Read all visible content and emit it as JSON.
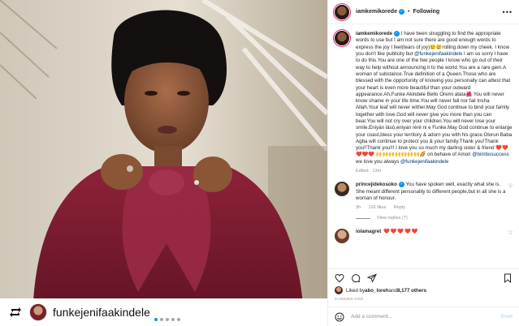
{
  "header": {
    "username": "iamkemikorede",
    "separator": "•",
    "follow_state": "Following",
    "more_icon": "more-horizontal-icon"
  },
  "caption": {
    "username": "iamkemikorede",
    "text_1": " I have been struggling to find the appropriate words to use but I am not sure there are good enough words to express the joy I feel(tears of joy)😢😢rolling down my cheek. I know you don't like publicity but ",
    "mention_1": "@funkejenifaakindele",
    "text_2": " I am so sorry I have to do this.You are one of the few people I know who go out of their way to help without announcing it to the world.You are a rare gem.A woman of substance.True definition of a Queen.Those who are blessed with the opportunity of knowing you personally can attest that your heart is even more beautiful than your outward appearance.Ah,Funke Akindele Bello Oremi atata🌺 You will never know shame in your life time.You will never fall nor fail Insha Allah.Your leaf will never wither.May God continue to bind your family together with love.God will never give you more than you can bear.You will not cry over your children.You will never lose your smile.Eniyàn lásò,eniyan rèré ni e Funke.May God continue to enlarge your coast,bless your territory & adorn you with his grace.Olorun Baba Agba will continue to protect you & your family.Thank you!Thank you!!Thank you!!! I love you so much my darling sister & friend ❤️❤️❤️❤️❤️ 🙌🙌🙌🙌🙌🙌🙌🌈 on behave of Amori ",
    "mention_2": "@bimbosuccess",
    "text_3": " we love you always ",
    "mention_3": "@funkejenifaakindele",
    "edited": "Edited · 13m"
  },
  "comments": [
    {
      "username": "princejidekosoko",
      "text": " You have spoken well, exactly what she is. She meant different personality to different people,but in all she is a woman of honour.",
      "time": "3h",
      "likes": "191 likes",
      "reply": "Reply",
      "view_replies": "View replies (7)"
    },
    {
      "username": "iolamagret",
      "text": " ❤️❤️❤️❤️❤️"
    }
  ],
  "likes": {
    "prefix": "Liked by ",
    "user": "abo_loreh",
    "middle": " and ",
    "count": "8,177 others"
  },
  "timestamp": "3 HOURS AGO",
  "add_comment": {
    "placeholder": "Add a comment...",
    "post_label": "Post"
  },
  "repost": {
    "username": "funkejenifaakindele"
  },
  "carousel": {
    "count": 5,
    "active_index": 0
  },
  "colors": {
    "accent_blue": "#0095f6",
    "mention_blue": "#00376b",
    "heart_red": "#ed4956",
    "blouse_burgundy": "#7e1c33"
  }
}
